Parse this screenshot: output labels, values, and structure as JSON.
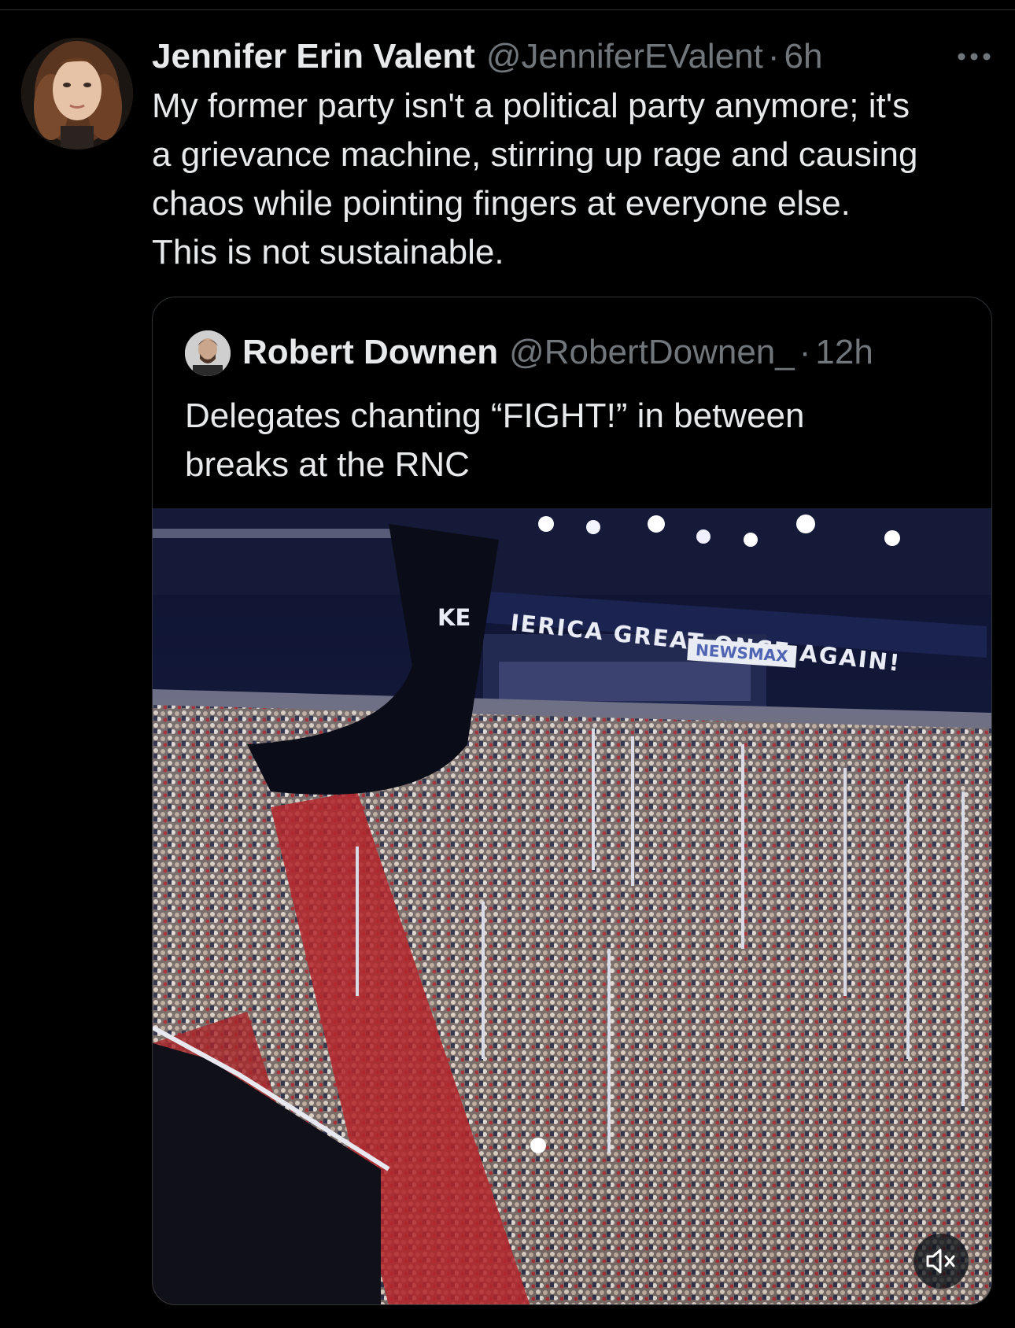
{
  "tweet": {
    "display_name": "Jennifer Erin Valent",
    "handle": "@JenniferEValent",
    "separator": "·",
    "time": "6h",
    "text_lines": [
      "My former party isn't a political party anymore; it's",
      "a grievance machine, stirring up rage and causing",
      "chaos while pointing fingers at everyone else.",
      "This is not sustainable."
    ],
    "avatar_icon": "user-avatar",
    "more_icon": "ellipsis-icon"
  },
  "quoted_tweet": {
    "display_name": "Robert Downen",
    "handle": "@RobertDownen_",
    "separator": "·",
    "time": "12h",
    "text_lines": [
      "Delegates chanting “FIGHT!” in between",
      "breaks at the RNC"
    ],
    "media": {
      "banner_left": "KE",
      "banner_main": "IERICA GREAT ONCE AGAIN!",
      "sign_text": "NEWSMAX",
      "mute_icon": "speaker-muted-icon"
    }
  },
  "colors": {
    "background": "#000000",
    "primary_text": "#e7e9ea",
    "secondary_text": "#71767b",
    "border": "#2f3336"
  }
}
